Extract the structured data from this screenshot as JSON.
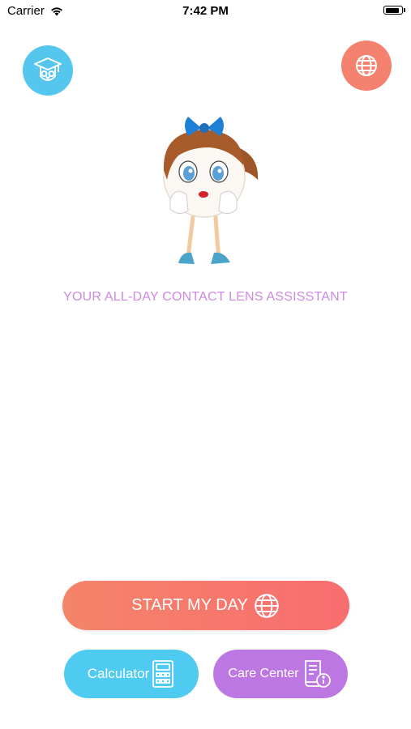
{
  "status_bar": {
    "carrier": "Carrier",
    "time": "7:42 PM",
    "battery_level": 0.9
  },
  "header": {
    "learn_icon": "graduation-owl-icon",
    "language_icon": "globe-icon"
  },
  "hero": {
    "mascot": "contact-lens-girl-mascot",
    "tagline": "YOUR ALL-DAY CONTACT LENS ASSISSTANT"
  },
  "actions": {
    "start_label": "START MY DAY",
    "start_icon": "globe-icon",
    "calculator_label": "Calculator",
    "calculator_icon": "calculator-icon",
    "care_center_label": "Care Center",
    "care_center_icon": "book-info-icon"
  },
  "colors": {
    "learn_button": "#55c6ee",
    "language_button": "#f4826e",
    "start_gradient_from": "#f5846a",
    "start_gradient_to": "#f86d6f",
    "calculator_button": "#4fcbf1",
    "care_center_button": "#bc77e3",
    "tagline": "#cc8be0"
  }
}
